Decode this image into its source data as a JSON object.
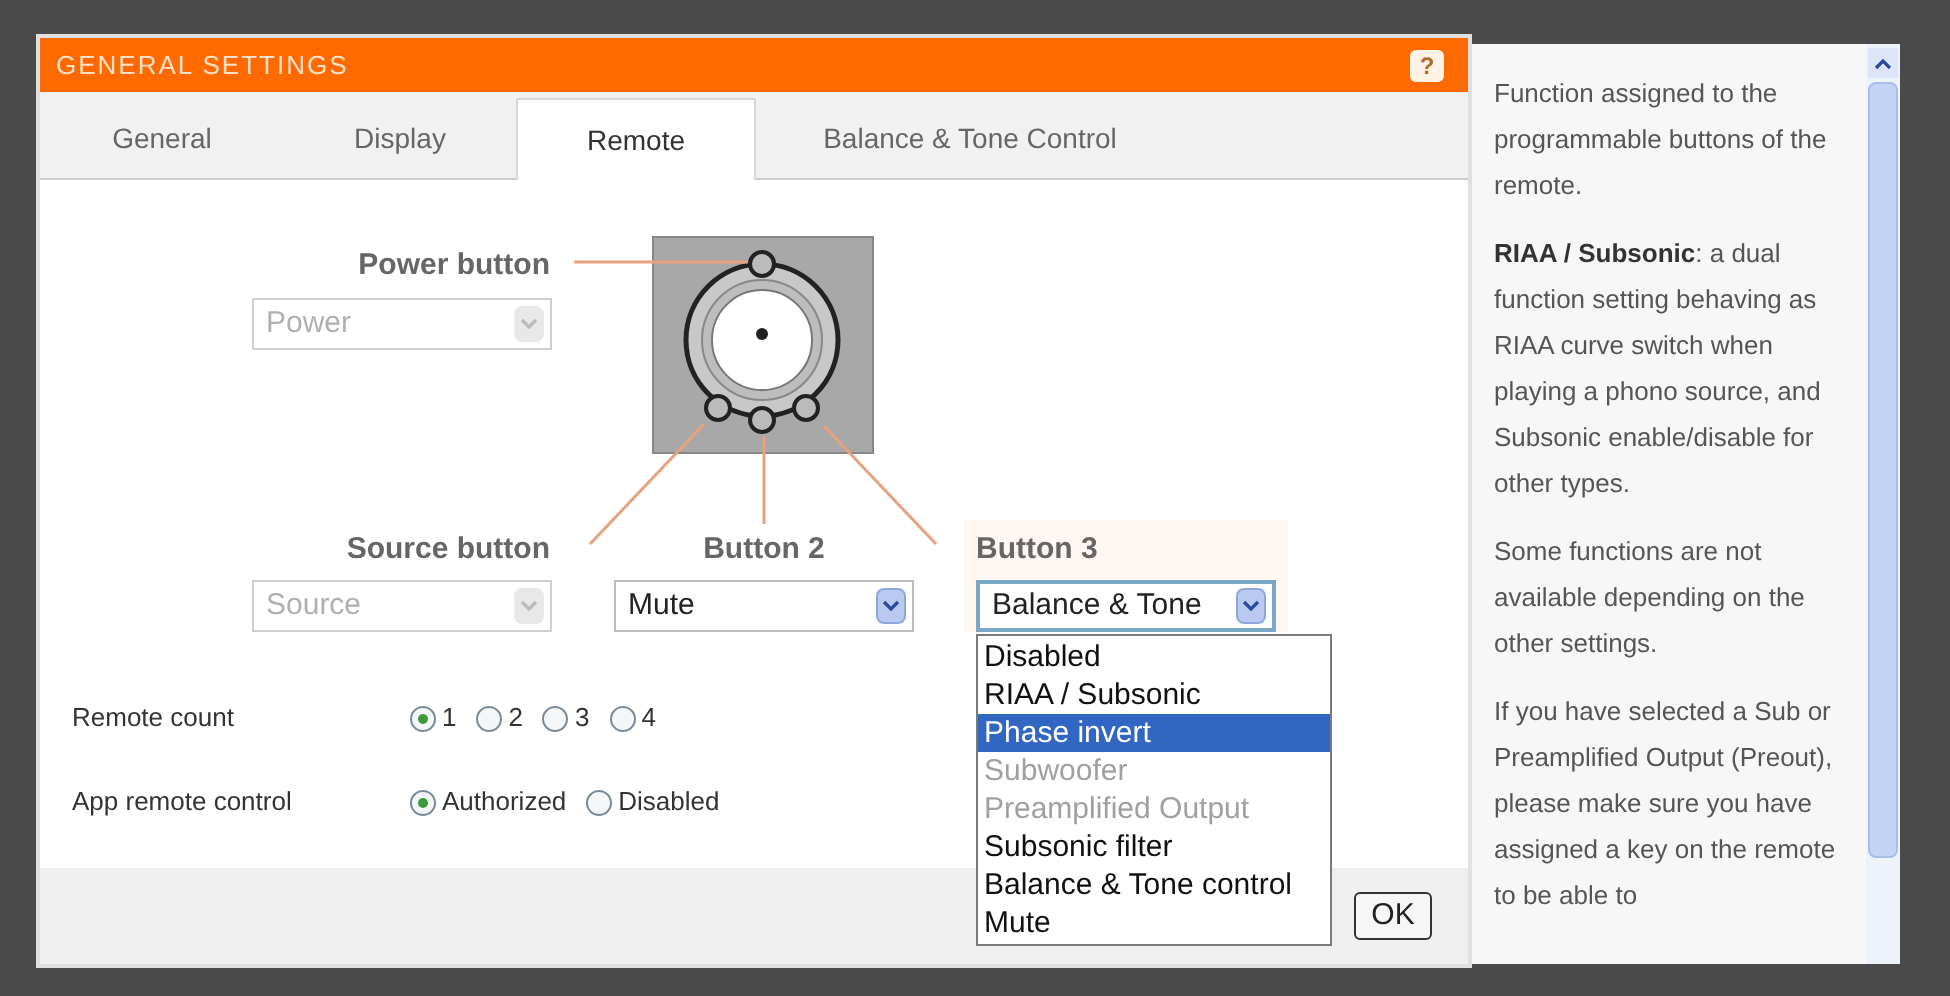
{
  "dialog": {
    "title": "GENERAL SETTINGS",
    "help_button": "?"
  },
  "tabs": [
    {
      "label": "General",
      "selected": false
    },
    {
      "label": "Display",
      "selected": false
    },
    {
      "label": "Remote",
      "selected": true
    },
    {
      "label": "Balance & Tone Control",
      "selected": false
    }
  ],
  "remote_buttons": [
    {
      "label": "Power button",
      "value": "Power",
      "disabled": true,
      "open": false
    },
    {
      "label": "Source button",
      "value": "Source",
      "disabled": true,
      "open": false
    },
    {
      "label": "Button 2",
      "value": "Mute",
      "disabled": false,
      "open": false
    },
    {
      "label": "Button 3",
      "value": "Balance & Tone",
      "disabled": false,
      "open": true
    }
  ],
  "dropdown_options": [
    {
      "label": "Disabled",
      "selected": false,
      "disabled": false
    },
    {
      "label": "RIAA / Subsonic",
      "selected": false,
      "disabled": false
    },
    {
      "label": "Phase invert",
      "selected": true,
      "disabled": false
    },
    {
      "label": "Subwoofer",
      "selected": false,
      "disabled": true
    },
    {
      "label": "Preamplified Output",
      "selected": false,
      "disabled": true
    },
    {
      "label": "Subsonic filter",
      "selected": false,
      "disabled": false
    },
    {
      "label": "Balance & Tone control",
      "selected": false,
      "disabled": false
    },
    {
      "label": "Mute",
      "selected": false,
      "disabled": false
    }
  ],
  "settings": [
    {
      "label": "Remote count",
      "options": [
        {
          "label": "1",
          "selected": true
        },
        {
          "label": "2",
          "selected": false
        },
        {
          "label": "3",
          "selected": false
        },
        {
          "label": "4",
          "selected": false
        }
      ]
    },
    {
      "label": "App remote control",
      "options": [
        {
          "label": "Authorized",
          "selected": true
        },
        {
          "label": "Disabled",
          "selected": false
        }
      ]
    }
  ],
  "ok_button": "OK",
  "help_panel": [
    "Function assigned to the programmable buttons of the remote.",
    "**RIAA / Subsonic**: a dual function setting behaving as RIAA curve switch when playing a phono source, and Subsonic enable/disable for other types.",
    "Some functions are not available depending on the other settings.",
    "If you have selected a Sub or Preamplified Output (Preout), please make sure you have assigned a key on the remote to be able to"
  ]
}
